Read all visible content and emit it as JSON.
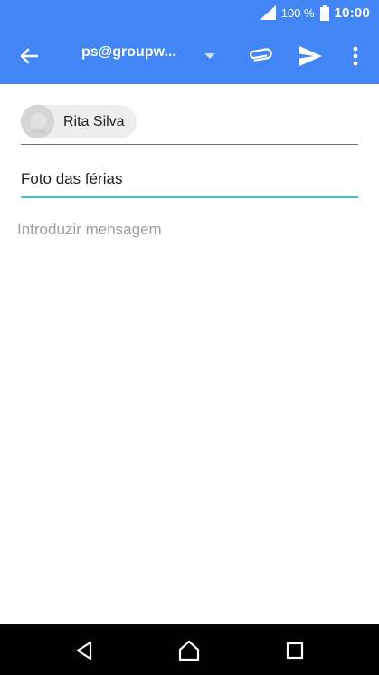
{
  "status_bar": {
    "battery_percent": "100 %",
    "time": "10:00",
    "icons": [
      "signal-icon",
      "battery-icon"
    ]
  },
  "app_bar": {
    "back_icon": "arrow-left-icon",
    "from_account": "ps@groupw...",
    "dropdown_icon": "triangle-down-icon",
    "attach_icon": "paperclip-icon",
    "send_icon": "send-icon",
    "more_icon": "more-vertical-icon"
  },
  "compose": {
    "recipient": {
      "name": "Rita Silva",
      "avatar_icon": "avatar-icon"
    },
    "subject_value": "Foto das férias",
    "body_placeholder": "Introduzir mensagem",
    "body_value": ""
  },
  "nav_bar": {
    "icons": [
      "nav-back-icon",
      "nav-home-icon",
      "nav-recent-icon"
    ]
  },
  "colors": {
    "primary": "#4285f4",
    "accent": "#3ec6c6",
    "chip": "#eeeeee",
    "nav_bar": "#000000"
  }
}
